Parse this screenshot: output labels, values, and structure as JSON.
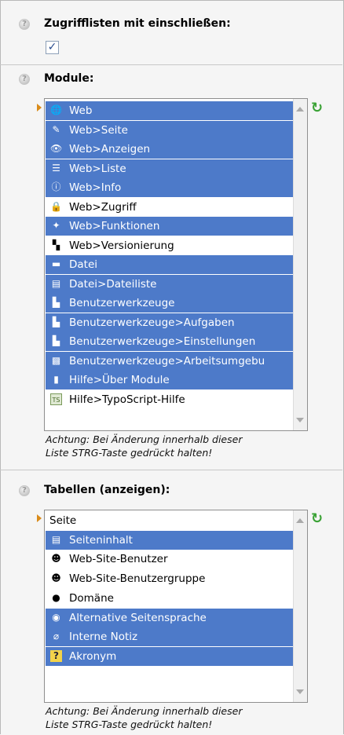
{
  "sections": {
    "access_lists": {
      "title": "Zugrifflisten mit einschließen:",
      "checked": true,
      "check_glyph": "✓"
    },
    "modules": {
      "title": "Module:",
      "items": [
        {
          "label": "Web",
          "selected": true,
          "icon": "globe-icon",
          "glyph": "🌐"
        },
        {
          "label": "Web>Seite",
          "selected": true,
          "icon": "page-edit-icon",
          "glyph": "✎"
        },
        {
          "label": "Web>Anzeigen",
          "selected": true,
          "icon": "eye-icon",
          "glyph": "👁"
        },
        {
          "label": "Web>Liste",
          "selected": true,
          "icon": "list-icon",
          "glyph": "☰"
        },
        {
          "label": "Web>Info",
          "selected": true,
          "icon": "info-icon",
          "glyph": "ⓘ"
        },
        {
          "label": "Web>Zugriff",
          "selected": false,
          "icon": "lock-icon",
          "glyph": "🔒"
        },
        {
          "label": "Web>Funktionen",
          "selected": true,
          "icon": "wand-icon",
          "glyph": "✦"
        },
        {
          "label": "Web>Versionierung",
          "selected": false,
          "icon": "versioning-icon",
          "glyph": "▚"
        },
        {
          "label": "Datei",
          "selected": true,
          "icon": "folder-icon",
          "glyph": "▬"
        },
        {
          "label": "Datei>Dateiliste",
          "selected": true,
          "icon": "filelist-icon",
          "glyph": "▤"
        },
        {
          "label": "Benutzerwerkzeuge",
          "selected": true,
          "icon": "user-tools-icon",
          "glyph": "▙"
        },
        {
          "label": "Benutzerwerkzeuge>Aufgaben",
          "selected": true,
          "icon": "tasks-icon",
          "glyph": "▙"
        },
        {
          "label": "Benutzerwerkzeuge>Einstellungen",
          "selected": true,
          "icon": "settings-icon",
          "glyph": "▙"
        },
        {
          "label": "Benutzerwerkzeuge>Arbeitsumgebu",
          "selected": true,
          "icon": "workspace-icon",
          "glyph": "▩"
        },
        {
          "label": "Hilfe>Über Module",
          "selected": true,
          "icon": "help-book-icon",
          "glyph": "▮"
        },
        {
          "label": "Hilfe>TypoScript-Hilfe",
          "selected": false,
          "icon": "typoscript-icon",
          "glyph": "TS"
        }
      ],
      "note_line1": "Achtung: Bei Änderung innerhalb dieser",
      "note_line2": "Liste STRG-Taste gedrückt halten!"
    },
    "tables": {
      "title": "Tabellen (anzeigen):",
      "items": [
        {
          "label": "Seite",
          "selected": false,
          "icon": "none",
          "glyph": ""
        },
        {
          "label": "Seiteninhalt",
          "selected": true,
          "icon": "content-icon",
          "glyph": "▤"
        },
        {
          "label": "Web-Site-Benutzer",
          "selected": false,
          "icon": "fe-user-icon",
          "glyph": "☻"
        },
        {
          "label": "Web-Site-Benutzergruppe",
          "selected": false,
          "icon": "fe-group-icon",
          "glyph": "☻"
        },
        {
          "label": "Domäne",
          "selected": false,
          "icon": "domain-icon",
          "glyph": "●"
        },
        {
          "label": "Alternative Seitensprache",
          "selected": true,
          "icon": "language-icon",
          "glyph": "◉"
        },
        {
          "label": "Interne Notiz",
          "selected": true,
          "icon": "note-icon",
          "glyph": "⌀"
        },
        {
          "label": "Akronym",
          "selected": true,
          "icon": "acronym-icon",
          "glyph": "?"
        }
      ],
      "note_line1": "Achtung: Bei Änderung innerhalb dieser",
      "note_line2": "Liste STRG-Taste gedrückt halten!"
    }
  },
  "colors": {
    "selection": "#4d7ac9",
    "marker": "#d98b1a",
    "reload": "#3aa235"
  }
}
